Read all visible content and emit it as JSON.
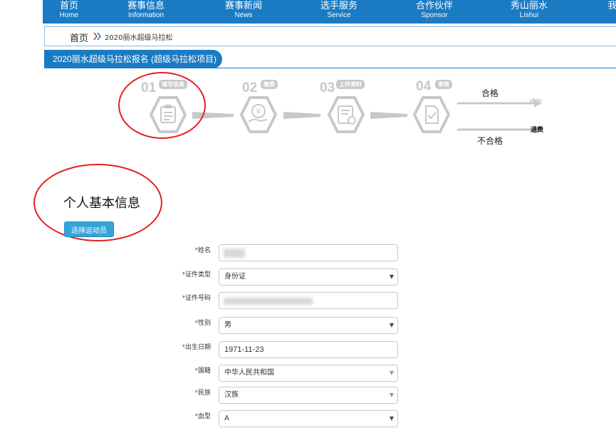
{
  "nav": {
    "items": [
      {
        "cn": "首页",
        "en": "Home"
      },
      {
        "cn": "赛事信息",
        "en": "Information"
      },
      {
        "cn": "赛事新闻",
        "en": "News"
      },
      {
        "cn": "选手服务",
        "en": "Service"
      },
      {
        "cn": "合作伙伴",
        "en": "Sponsor"
      },
      {
        "cn": "秀山丽水",
        "en": "Lishui"
      },
      {
        "cn": "我",
        "en": ""
      }
    ]
  },
  "breadcrumb": {
    "home": "首页",
    "current": "2020丽水超级马拉松"
  },
  "page_title": "2020丽水超级马拉松报名 (超级马拉松项目)",
  "steps": [
    {
      "num": "01",
      "label": "填写信息",
      "icon": "clipboard-icon"
    },
    {
      "num": "02",
      "label": "缴费",
      "icon": "payment-icon"
    },
    {
      "num": "03",
      "label": "上传资料",
      "icon": "certificate-icon"
    },
    {
      "num": "04",
      "label": "审核",
      "icon": "check-document-icon"
    }
  ],
  "results": {
    "pass_label": "合格",
    "pass_text": "成功",
    "fail_label": "不合格",
    "fail_text": "退费"
  },
  "section": {
    "title": "个人基本信息",
    "select_button": "选择运动员"
  },
  "form": {
    "name_label": "姓名",
    "id_type_label": "证件类型",
    "id_type_value": "身份证",
    "id_number_label": "证件号码",
    "gender_label": "性别",
    "gender_value": "男",
    "birthdate_label": "出生日期",
    "birthdate_value": "1971-11-23",
    "nationality_label": "国籍",
    "nationality_value": "中华人民共和国",
    "ethnicity_label": "民族",
    "ethnicity_value": "汉族",
    "blood_label": "血型",
    "blood_value": "A"
  },
  "colors": {
    "primary": "#1a7bc3",
    "button": "#36a3d8",
    "step_gray": "#c8c8c8",
    "annotation_red": "#e3201c"
  }
}
